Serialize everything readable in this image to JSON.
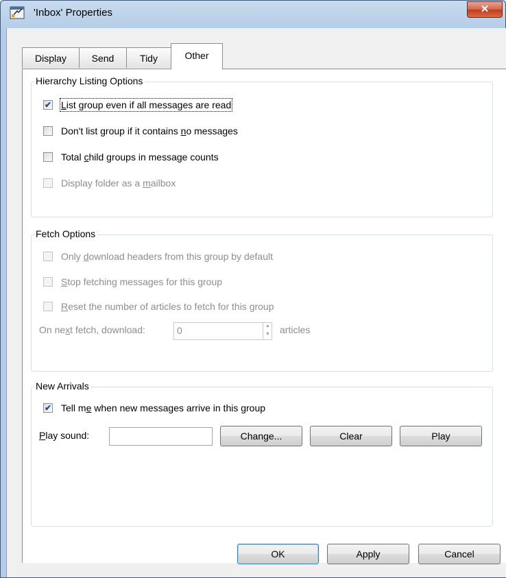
{
  "window": {
    "title": "'Inbox' Properties",
    "close_glyph": "✕",
    "icon": "properties-window-icon"
  },
  "tabs": [
    {
      "label": "Display",
      "active": false
    },
    {
      "label": "Send",
      "active": false
    },
    {
      "label": "Tidy",
      "active": false
    },
    {
      "label": "Other",
      "active": true
    }
  ],
  "hierarchy": {
    "legend": "Hierarchy Listing Options",
    "options": [
      {
        "pre": "",
        "mnemonic": "L",
        "post": "ist group even if all messages are read",
        "checked": true,
        "enabled": true
      },
      {
        "pre": "Don't list group if it contains ",
        "mnemonic": "n",
        "post": "o messages",
        "checked": false,
        "enabled": true
      },
      {
        "pre": "Total ",
        "mnemonic": "c",
        "post": "hild groups in message counts",
        "checked": false,
        "enabled": true
      },
      {
        "pre": "Display folder as a ",
        "mnemonic": "m",
        "post": "ailbox",
        "checked": false,
        "enabled": false
      }
    ]
  },
  "fetch": {
    "legend": "Fetch Options",
    "options": [
      {
        "pre": "Only ",
        "mnemonic": "d",
        "post": "ownload headers from this group by default",
        "checked": false,
        "enabled": false
      },
      {
        "pre": "",
        "mnemonic": "S",
        "post": "top fetching messages for this group",
        "checked": false,
        "enabled": false
      },
      {
        "pre": "",
        "mnemonic": "R",
        "post": "eset the number of articles to fetch for this group",
        "checked": false,
        "enabled": false
      }
    ],
    "next_fetch": {
      "pre": "On ne",
      "mnemonic": "x",
      "post": "t fetch, download:",
      "value": "0",
      "unit": "articles"
    }
  },
  "arrivals": {
    "legend": "New Arrivals",
    "option": {
      "pre": "Tell m",
      "mnemonic": "e",
      "post": " when new messages arrive in this group",
      "checked": true,
      "enabled": true
    },
    "sound_label": {
      "pre": "",
      "mnemonic": "P",
      "post": "lay sound:"
    },
    "sound_value": "",
    "buttons": {
      "change": "Change...",
      "clear": "Clear",
      "play": "Play"
    }
  },
  "footer": {
    "ok": "OK",
    "apply": "Apply",
    "cancel": "Cancel"
  }
}
